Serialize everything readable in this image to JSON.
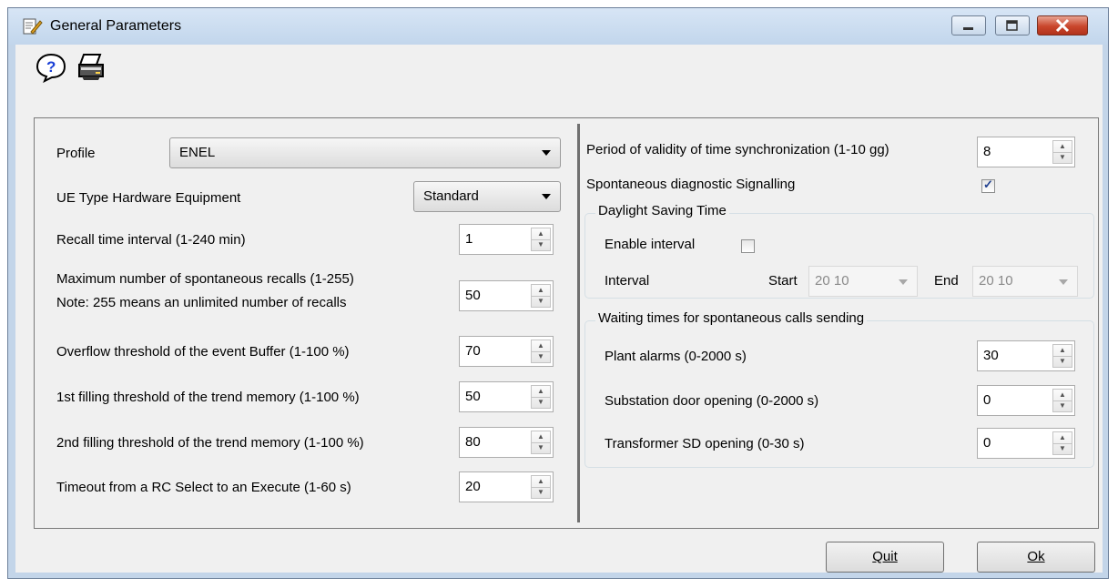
{
  "window": {
    "title": "General Parameters",
    "title_icon": "edit-document-icon"
  },
  "toolbar": {
    "help_icon": "help-icon",
    "print_icon": "printer-icon"
  },
  "left": {
    "profile_label": "Profile",
    "profile_value": "ENEL",
    "ue_type_label": "UE Type Hardware Equipment",
    "ue_type_value": "Standard",
    "recall_interval_label": "Recall time interval (1-240 min)",
    "recall_interval_value": "1",
    "max_recalls_label": "Maximum number of spontaneous recalls (1-255)",
    "max_recalls_note": "Note: 255 means an unlimited number of recalls",
    "max_recalls_value": "50",
    "overflow_label": "Overflow threshold of the event Buffer  (1-100 %)",
    "overflow_value": "70",
    "first_fill_label": "1st filling threshold of the trend memory (1-100 %)",
    "first_fill_value": "50",
    "second_fill_label": "2nd filling threshold of the trend memory (1-100 %)",
    "second_fill_value": "80",
    "timeout_label": "Timeout from a RC Select to an Execute (1-60 s)",
    "timeout_value": "20"
  },
  "right": {
    "validity_label": "Period of validity of time synchronization (1-10 gg)",
    "validity_value": "8",
    "diag_label": "Spontaneous diagnostic Signalling",
    "diag_checked": true,
    "dst": {
      "title": "Daylight Saving Time",
      "enable_label": "Enable interval",
      "enable_checked": false,
      "interval_label": "Interval",
      "start_label": "Start",
      "start_value": "20 10",
      "end_label": "End",
      "end_value": "20 10"
    },
    "waiting": {
      "title": "Waiting times for spontaneous calls sending",
      "plant_label": "Plant alarms (0-2000 s)",
      "plant_value": "30",
      "door_label": "Substation door opening (0-2000 s)",
      "door_value": "0",
      "transformer_label": "Transformer SD opening (0-30 s)",
      "transformer_value": "0"
    }
  },
  "buttons": {
    "quit": "Quit",
    "ok": "Ok"
  }
}
